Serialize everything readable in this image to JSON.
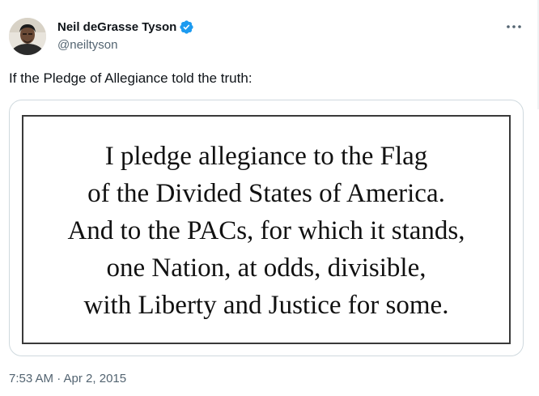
{
  "author": {
    "display_name": "Neil deGrasse Tyson",
    "handle": "@neiltyson",
    "verified_icon": "verified-badge-icon",
    "avatar_icon": "profile-photo"
  },
  "tweet": {
    "text": "If the Pledge of Allegiance told the truth:",
    "timestamp": "7:53 AM · Apr 2, 2015"
  },
  "media": {
    "lines": [
      "I pledge allegiance to the Flag",
      "of the Divided States of America.",
      "And to the PACs, for which it stands,",
      "one Nation, at odds, divisible,",
      "with Liberty and Justice for some."
    ]
  },
  "controls": {
    "more_icon": "more-options-icon"
  },
  "colors": {
    "verified_blue": "#1d9bf0",
    "secondary_text": "#536471",
    "primary_text": "#0f1419",
    "card_border": "#cfd9de"
  }
}
